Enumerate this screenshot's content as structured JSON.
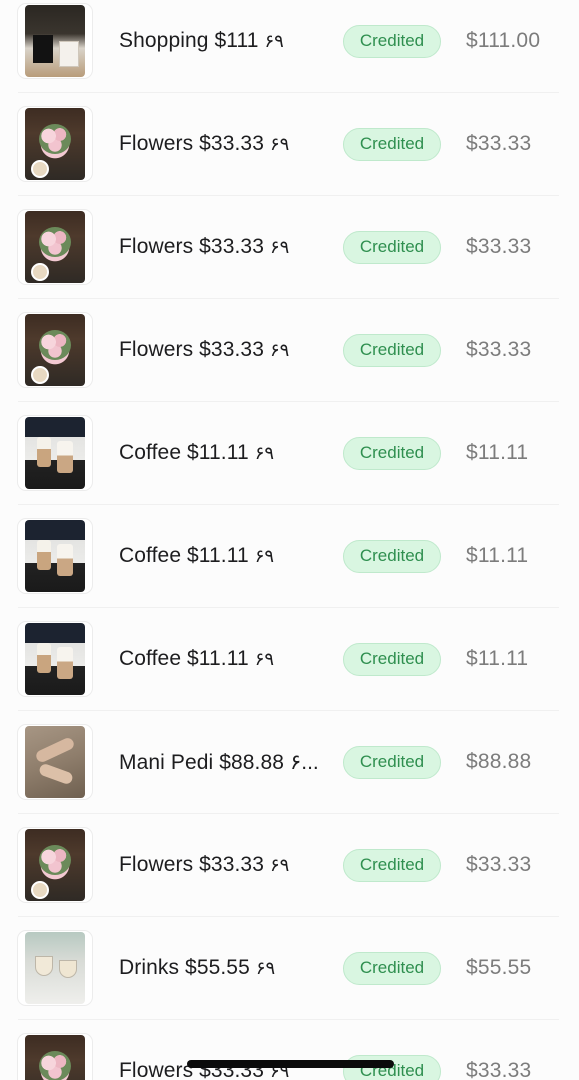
{
  "transactions": [
    {
      "title": "Shopping $111",
      "glyph": "۶۹",
      "status": "Credited",
      "amount": "$111.00",
      "thumb": "shopping-photo"
    },
    {
      "title": "Flowers $33.33",
      "glyph": "۶۹",
      "status": "Credited",
      "amount": "$33.33",
      "thumb": "flowers-photo"
    },
    {
      "title": "Flowers $33.33",
      "glyph": "۶۹",
      "status": "Credited",
      "amount": "$33.33",
      "thumb": "flowers-photo"
    },
    {
      "title": "Flowers $33.33",
      "glyph": "۶۹",
      "status": "Credited",
      "amount": "$33.33",
      "thumb": "flowers-photo"
    },
    {
      "title": "Coffee $11.11",
      "glyph": "۶۹",
      "status": "Credited",
      "amount": "$11.11",
      "thumb": "coffee-photo"
    },
    {
      "title": "Coffee $11.11",
      "glyph": "۶۹",
      "status": "Credited",
      "amount": "$11.11",
      "thumb": "coffee-photo"
    },
    {
      "title": "Coffee $11.11",
      "glyph": "۶۹",
      "status": "Credited",
      "amount": "$11.11",
      "thumb": "coffee-photo"
    },
    {
      "title": "Mani Pedi $88.88 ۶...",
      "glyph": "",
      "status": "Credited",
      "amount": "$88.88",
      "thumb": "mani-pedi-photo"
    },
    {
      "title": "Flowers $33.33",
      "glyph": "۶۹",
      "status": "Credited",
      "amount": "$33.33",
      "thumb": "flowers-photo"
    },
    {
      "title": "Drinks $55.55",
      "glyph": "۶۹",
      "status": "Credited",
      "amount": "$55.55",
      "thumb": "drinks-photo"
    },
    {
      "title": "Flowers $33.33",
      "glyph": "۶۹",
      "status": "Credited",
      "amount": "$33.33",
      "thumb": "flowers-photo"
    }
  ],
  "colors": {
    "badge_bg": "#d9f6e1",
    "badge_text": "#2f8f4f",
    "amount_text": "#7c7c7c",
    "title_text": "#1d1d1f"
  }
}
